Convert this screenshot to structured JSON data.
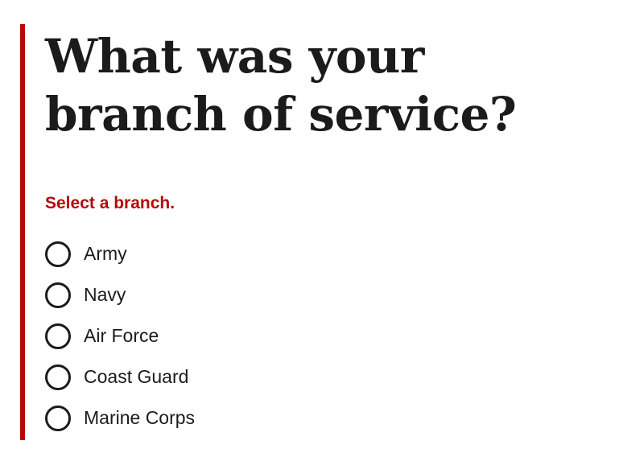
{
  "question": {
    "title": "What was your branch of service?",
    "error_message": "Select a branch."
  },
  "options": [
    {
      "label": "Army",
      "selected": false
    },
    {
      "label": "Navy",
      "selected": false
    },
    {
      "label": "Air Force",
      "selected": false
    },
    {
      "label": "Coast Guard",
      "selected": false
    },
    {
      "label": "Marine Corps",
      "selected": false
    }
  ],
  "colors": {
    "error_accent": "#b50909",
    "text": "#1b1b1b",
    "background": "#ffffff"
  }
}
